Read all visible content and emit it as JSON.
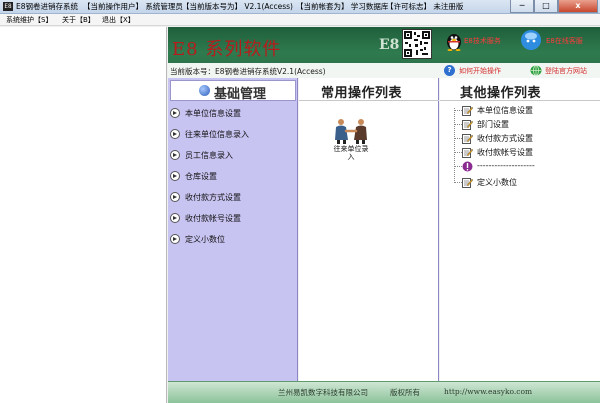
{
  "window": {
    "app_icon_text": "E8",
    "title_app": "E8钢卷进销存系统",
    "title_user": "【当前操作用户】 系统管理员",
    "title_version": "【当前版本号为】 V2.1(Access)",
    "title_account": "【当前帐套为】 学习数据库",
    "title_license": "【许可标志】 未注册版",
    "controls": {
      "minimize": "─",
      "maximize": "□",
      "close": "x"
    }
  },
  "menu": [
    {
      "label": "系统维护【S】"
    },
    {
      "label": "关于【B】"
    },
    {
      "label": "退出【X】"
    }
  ],
  "banner": {
    "title": "E8 系列软件",
    "logo": "E8",
    "qq1_label": "E8技术服务",
    "qq2_label": "E8在线客服",
    "version_label": "当前版本号：E8钢卷进销存系统V2.1(Access)",
    "howto_label": "如何开始操作",
    "site_label": "登陆官方网站"
  },
  "sidebar": {
    "heading": "基础管理",
    "items": [
      {
        "label": "本单位信息设置"
      },
      {
        "label": "往来单位信息录入"
      },
      {
        "label": "员工信息录入"
      },
      {
        "label": "仓库设置"
      },
      {
        "label": "收付款方式设置"
      },
      {
        "label": "收付款帐号设置"
      },
      {
        "label": "定义小数位"
      }
    ]
  },
  "center": {
    "heading": "常用操作列表",
    "shortcut_label": "往来单位录 入"
  },
  "right": {
    "heading": "其他操作列表",
    "items": [
      {
        "label": "本单位信息设置",
        "icon": "edit-icon"
      },
      {
        "label": "部门设置",
        "icon": "edit-icon"
      },
      {
        "label": "收付款方式设置",
        "icon": "edit-icon"
      },
      {
        "label": "收付款帐号设置",
        "icon": "edit-icon"
      },
      {
        "label": "--------------------",
        "icon": "info-icon"
      },
      {
        "label": "定义小数位",
        "icon": "edit-icon"
      }
    ]
  },
  "footer": {
    "company": "兰州易凯数字科技有限公司",
    "rights": "版权所有",
    "url": "http://www.easyko.com"
  },
  "colors": {
    "banner_green": "#2f7a4f",
    "banner_title_red": "#b71c1c",
    "sidebar_lavender": "#c8c4f2",
    "footer_green": "#8bc39a"
  }
}
